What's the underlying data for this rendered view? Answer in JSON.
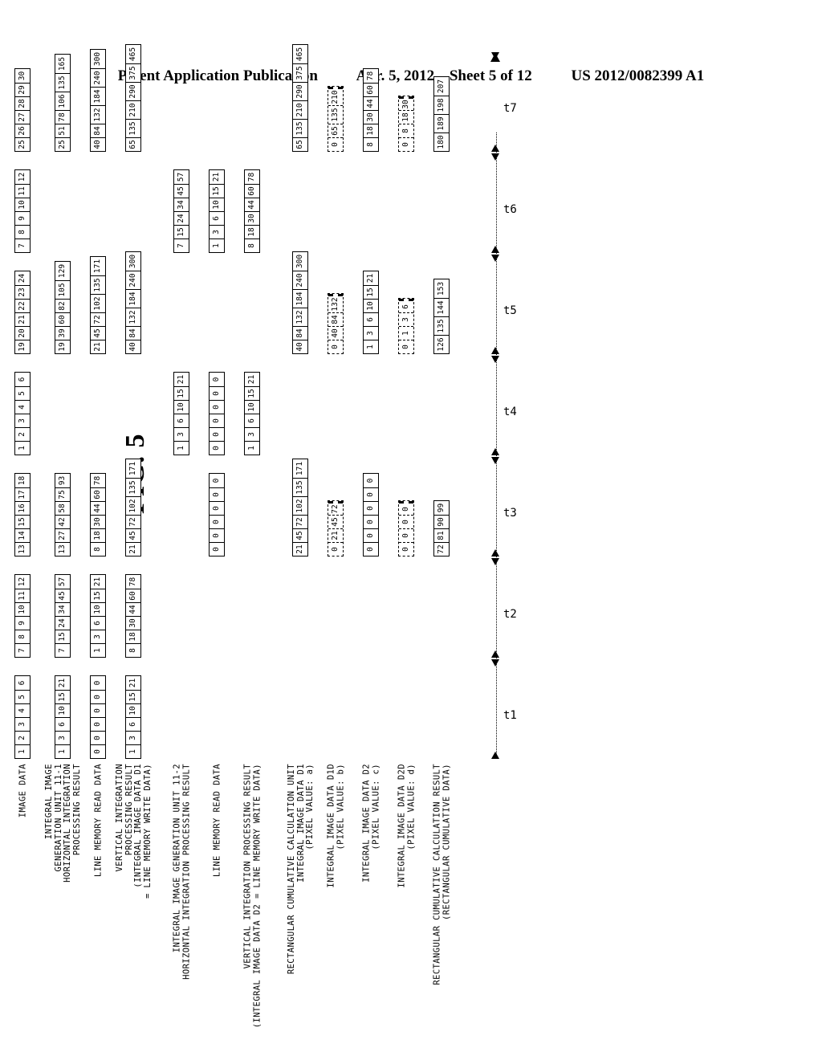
{
  "header": {
    "publication": "Patent Application Publication",
    "date": "Apr. 5, 2012",
    "sheet": "Sheet 5 of 12",
    "patent_number": "US 2012/0082399 A1"
  },
  "figure": {
    "title": "FIG. 5"
  },
  "timeline": {
    "labels": [
      "t1",
      "t2",
      "t3",
      "t4",
      "t5",
      "t6",
      "t7"
    ]
  },
  "rows": [
    {
      "id": "image-data",
      "label": "IMAGE DATA",
      "groups": [
        {
          "t": "t1",
          "values": [
            "1",
            "2",
            "3",
            "4",
            "5",
            "6"
          ]
        },
        {
          "t": "t2",
          "values": [
            "7",
            "8",
            "9",
            "10",
            "11",
            "12"
          ]
        },
        {
          "t": "t3",
          "values": [
            "13",
            "14",
            "15",
            "16",
            "17",
            "18"
          ]
        },
        {
          "t": "t4",
          "values": [
            "1",
            "2",
            "3",
            "4",
            "5",
            "6"
          ]
        },
        {
          "t": "t5",
          "values": [
            "19",
            "20",
            "21",
            "22",
            "23",
            "24"
          ]
        },
        {
          "t": "t6",
          "values": [
            "7",
            "8",
            "9",
            "10",
            "11",
            "12"
          ]
        },
        {
          "t": "t7",
          "values": [
            "25",
            "26",
            "27",
            "28",
            "29",
            "30"
          ]
        }
      ]
    },
    {
      "id": "horizontal-integration-11-1",
      "label": "INTEGRAL IMAGE\nGENERATION UNIT 11-1\nHORIZONTAL INTEGRATION\nPROCESSING RESULT",
      "groups": [
        {
          "t": "t1",
          "values": [
            "1",
            "3",
            "6",
            "10",
            "15",
            "21"
          ]
        },
        {
          "t": "t2",
          "values": [
            "7",
            "15",
            "24",
            "34",
            "45",
            "57"
          ]
        },
        {
          "t": "t3",
          "values": [
            "13",
            "27",
            "42",
            "58",
            "75",
            "93"
          ]
        },
        {
          "t": "t5",
          "values": [
            "19",
            "39",
            "60",
            "82",
            "105",
            "129"
          ]
        },
        {
          "t": "t7",
          "values": [
            "25",
            "51",
            "78",
            "106",
            "135",
            "165"
          ]
        }
      ]
    },
    {
      "id": "line-memory-read-data-1",
      "label": "LINE MEMORY READ DATA",
      "groups": [
        {
          "t": "t1",
          "values": [
            "0",
            "0",
            "0",
            "0",
            "0",
            "0"
          ]
        },
        {
          "t": "t2",
          "values": [
            "1",
            "3",
            "6",
            "10",
            "15",
            "21"
          ]
        },
        {
          "t": "t3",
          "values": [
            "8",
            "18",
            "30",
            "44",
            "60",
            "78"
          ]
        },
        {
          "t": "t5",
          "values": [
            "21",
            "45",
            "72",
            "102",
            "135",
            "171"
          ]
        },
        {
          "t": "t7",
          "values": [
            "40",
            "84",
            "132",
            "184",
            "240",
            "300"
          ]
        }
      ]
    },
    {
      "id": "vertical-integration-d1",
      "label": "VERTICAL INTEGRATION\nPROCESSING RESULT\n(INTEGRAL IMAGE DATA D1\n= LINE MEMORY WRITE DATA)",
      "groups": [
        {
          "t": "t1",
          "values": [
            "1",
            "3",
            "6",
            "10",
            "15",
            "21"
          ]
        },
        {
          "t": "t2",
          "values": [
            "8",
            "18",
            "30",
            "44",
            "60",
            "78"
          ]
        },
        {
          "t": "t3",
          "values": [
            "21",
            "45",
            "72",
            "102",
            "135",
            "171"
          ]
        },
        {
          "t": "t5",
          "values": [
            "40",
            "84",
            "132",
            "184",
            "240",
            "300"
          ]
        },
        {
          "t": "t7",
          "values": [
            "65",
            "135",
            "210",
            "290",
            "375",
            "465"
          ]
        }
      ]
    },
    {
      "id": "horizontal-integration-11-2",
      "label": "INTEGRAL IMAGE GENERATION UNIT 11-2\nHORIZONTAL INTEGRATION PROCESSING RESULT",
      "groups": [
        {
          "t": "t4",
          "values": [
            "1",
            "3",
            "6",
            "10",
            "15",
            "21"
          ]
        },
        {
          "t": "t6",
          "values": [
            "7",
            "15",
            "24",
            "34",
            "45",
            "57"
          ]
        }
      ]
    },
    {
      "id": "line-memory-read-data-2",
      "label": "LINE MEMORY READ DATA",
      "groups": [
        {
          "t": "t3",
          "values": [
            "0",
            "0",
            "0",
            "0",
            "0",
            "0"
          ]
        },
        {
          "t": "t4",
          "values": [
            "0",
            "0",
            "0",
            "0",
            "0",
            "0"
          ]
        },
        {
          "t": "t6",
          "values": [
            "1",
            "3",
            "6",
            "10",
            "15",
            "21"
          ]
        }
      ]
    },
    {
      "id": "vertical-integration-d2",
      "label": "VERTICAL INTEGRATION PROCESSING RESULT\n(INTEGRAL IMAGE DATA D2 = LINE MEMORY WRITE DATA)",
      "groups": [
        {
          "t": "t4",
          "values": [
            "1",
            "3",
            "6",
            "10",
            "15",
            "21"
          ]
        },
        {
          "t": "t6",
          "values": [
            "8",
            "18",
            "30",
            "44",
            "60",
            "78"
          ]
        }
      ]
    },
    {
      "id": "rect-cumulative-d1",
      "label": "RECTANGULAR CUMULATIVE CALCULATION UNIT\nINTEGRAL IMAGE DATA D1\n(PIXEL VALUE: a)",
      "groups": [
        {
          "t": "t3",
          "values": [
            "21",
            "45",
            "72",
            "102",
            "135",
            "171"
          ]
        },
        {
          "t": "t5",
          "values": [
            "40",
            "84",
            "132",
            "184",
            "240",
            "300"
          ]
        },
        {
          "t": "t7",
          "values": [
            "65",
            "135",
            "210",
            "290",
            "375",
            "465"
          ]
        }
      ]
    },
    {
      "id": "rect-cumulative-d1d",
      "label": "INTEGRAL IMAGE DATA D1D\n(PIXEL VALUE: b)",
      "dashed": true,
      "groups": [
        {
          "t": "t3",
          "values": [
            "0",
            "21",
            "45",
            "72"
          ]
        },
        {
          "t": "t5",
          "values": [
            "0",
            "40",
            "84",
            "132"
          ]
        },
        {
          "t": "t7",
          "values": [
            "0",
            "65",
            "135",
            "210"
          ]
        }
      ]
    },
    {
      "id": "rect-cumulative-d2",
      "label": "INTEGRAL IMAGE DATA D2\n(PIXEL VALUE: c)",
      "groups": [
        {
          "t": "t3",
          "values": [
            "0",
            "0",
            "0",
            "0",
            "0",
            "0"
          ]
        },
        {
          "t": "t5",
          "values": [
            "1",
            "3",
            "6",
            "10",
            "15",
            "21"
          ]
        },
        {
          "t": "t7",
          "values": [
            "8",
            "18",
            "30",
            "44",
            "60",
            "78"
          ]
        }
      ]
    },
    {
      "id": "rect-cumulative-d2d",
      "label": "INTEGRAL IMAGE DATA D2D\n(PIXEL VALUE: d)",
      "dashed": true,
      "groups": [
        {
          "t": "t3",
          "values": [
            "0",
            "0",
            "0",
            "0"
          ]
        },
        {
          "t": "t5",
          "values": [
            "0",
            "1",
            "3",
            "6"
          ]
        },
        {
          "t": "t7",
          "values": [
            "0",
            "8",
            "18",
            "30"
          ]
        }
      ]
    },
    {
      "id": "rect-cumulative-result",
      "label": "RECTANGULAR CUMULATIVE CALCULATION RESULT\n(RECTANGULAR CUMULATIVE DATA)",
      "groups": [
        {
          "t": "t3",
          "values": [
            "72",
            "81",
            "90",
            "99"
          ]
        },
        {
          "t": "t5",
          "values": [
            "126",
            "135",
            "144",
            "153"
          ]
        },
        {
          "t": "t7",
          "values": [
            "180",
            "189",
            "198",
            "207"
          ]
        }
      ]
    }
  ]
}
